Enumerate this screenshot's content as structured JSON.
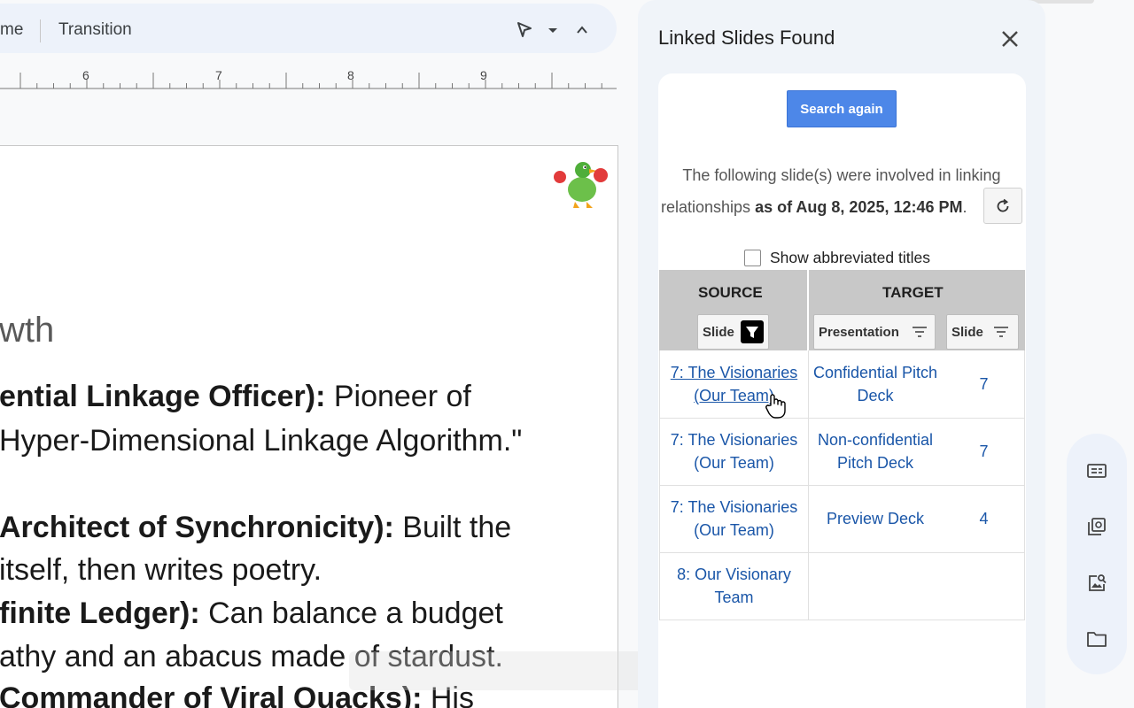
{
  "toolbar": {
    "partial_label": "me",
    "transition_label": "Transition"
  },
  "ruler": {
    "ticks": [
      "6",
      "7",
      "8",
      "9"
    ]
  },
  "slide": {
    "title_fragment": "wth",
    "lines": [
      {
        "bold": "ential Linkage Officer):",
        "text": " Pioneer of"
      },
      {
        "bold": "",
        "text": "Hyper-Dimensional Linkage Algorithm.\""
      },
      {
        "bold": " Architect of Synchronicity):",
        "text": " Built the"
      },
      {
        "bold": "",
        "text": " itself, then writes poetry."
      },
      {
        "bold": "finite Ledger):",
        "text": " Can balance a budget"
      },
      {
        "bold": "",
        "text": "athy and an abacus made of stardust."
      },
      {
        "bold": "Commander of Viral Quacks):",
        "text": " His"
      }
    ]
  },
  "panel": {
    "title": "Linked Slides Found",
    "search_again": "Search again",
    "info_line1": "The following slide(s) were involved in linking",
    "info_prefix": "relationships ",
    "info_bold": "as of Aug 8, 2025, 12:46 PM",
    "info_suffix": ".",
    "show_abbreviated": "Show abbreviated titles",
    "table": {
      "source_header": "SOURCE",
      "target_header": "TARGET",
      "filter_slide_src": "Slide",
      "filter_presentation": "Presentation",
      "filter_slide_tgt": "Slide",
      "rows": [
        {
          "source": [
            "7: The Visionaries",
            "(Our Team)"
          ],
          "presentation": [
            "Confidential Pitch",
            "Deck"
          ],
          "slide": "7"
        },
        {
          "source": [
            "7: The Visionaries",
            "(Our Team)"
          ],
          "presentation": [
            "Non-confidential",
            "Pitch Deck"
          ],
          "slide": "7"
        },
        {
          "source": [
            "7: The Visionaries",
            "(Our Team)"
          ],
          "presentation": [
            "Preview Deck",
            ""
          ],
          "slide": "4"
        },
        {
          "source": [
            "8: Our Visionary",
            "Team"
          ],
          "presentation": [
            "",
            ""
          ],
          "slide": ""
        }
      ]
    }
  },
  "rail": {
    "icons": [
      "speaker-notes-icon",
      "slide-library-icon",
      "image-search-icon",
      "folder-icon"
    ]
  }
}
